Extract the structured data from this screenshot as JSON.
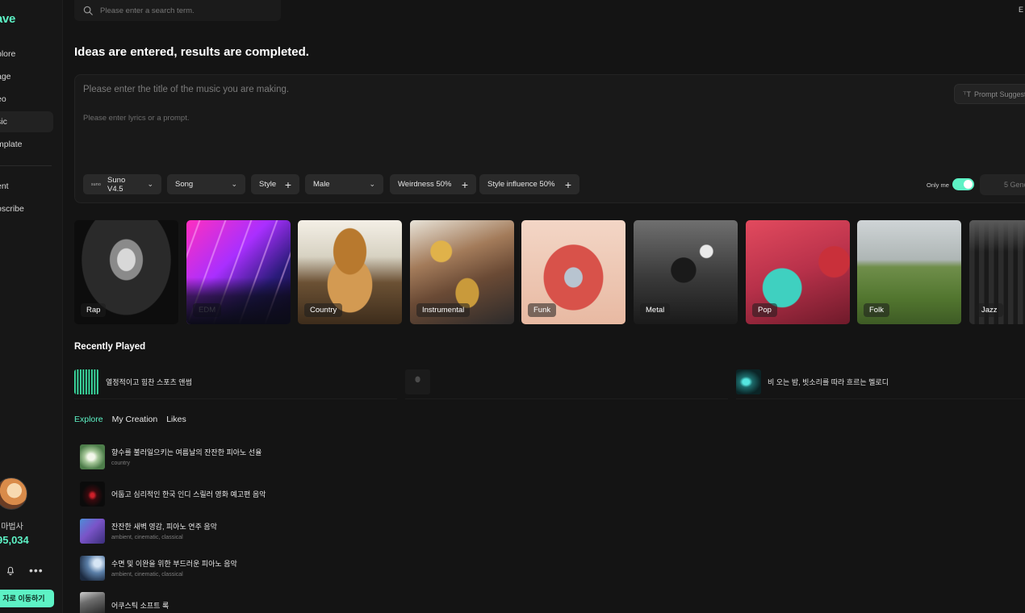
{
  "app": {
    "logo": "Vave"
  },
  "sidebar": {
    "items": [
      {
        "label": "plore"
      },
      {
        "label": "age"
      },
      {
        "label": "eo"
      },
      {
        "label": "sic"
      },
      {
        "label": "mplate"
      },
      {
        "label": "ent"
      },
      {
        "label": "oscribe"
      }
    ],
    "active_index": 3,
    "user": {
      "name": "성마법사",
      "credits": "95,034"
    },
    "cta_label": "자로 이동하기"
  },
  "search": {
    "placeholder": "Please enter a search term."
  },
  "lang": {
    "label": "E"
  },
  "headline": "Ideas are entered, results are completed.",
  "composer": {
    "title_placeholder": "Please enter the title of the music you are making.",
    "lyrics_placeholder": "Please enter lyrics or a prompt.",
    "prompt_suggest_label": "Prompt Suggest",
    "model_badge": "suno",
    "model": "Suno V4.5",
    "type": "Song",
    "style": "Style",
    "voice": "Male",
    "weirdness": "Weirdness 50%",
    "style_influence": "Style influence 50%",
    "only_me_label": "Only me",
    "generate_label": "5 Gene"
  },
  "genres": [
    {
      "label": "Rap"
    },
    {
      "label": "EDM"
    },
    {
      "label": "Country"
    },
    {
      "label": "Instrumental"
    },
    {
      "label": "Funk"
    },
    {
      "label": "Metal"
    },
    {
      "label": "Pop"
    },
    {
      "label": "Folk"
    },
    {
      "label": "Jazz"
    }
  ],
  "recently_played": {
    "title": "Recently Played",
    "items": [
      {
        "title": "열정적이고 힘찬 스포츠 앤썸"
      },
      {
        "title": ""
      },
      {
        "title": "비 오는 밤, 빗소리를 따라 흐르는 멜로디"
      }
    ]
  },
  "tabs": [
    {
      "label": "Explore"
    },
    {
      "label": "My Creation"
    },
    {
      "label": "Likes"
    }
  ],
  "tracks": [
    {
      "title": "향수를 불러일으키는 여름날의 잔잔한 피아노 선율",
      "tags": "country"
    },
    {
      "title": "어둡고 심리적인 한국 인디 스릴러 영화 예고편 음악",
      "tags": ""
    },
    {
      "title": "잔잔한 새벽 영감, 피아노 연주 음악",
      "tags": "ambient, cinematic, classical"
    },
    {
      "title": "수면 및 이완을 위한 부드러운 피아노 음악",
      "tags": "ambient, cinematic, classical"
    },
    {
      "title": "어쿠스틱 소프트 록",
      "tags": ""
    }
  ],
  "colors": {
    "accent": "#5df2c5",
    "background": "#141414",
    "sidebar": "#171717"
  }
}
